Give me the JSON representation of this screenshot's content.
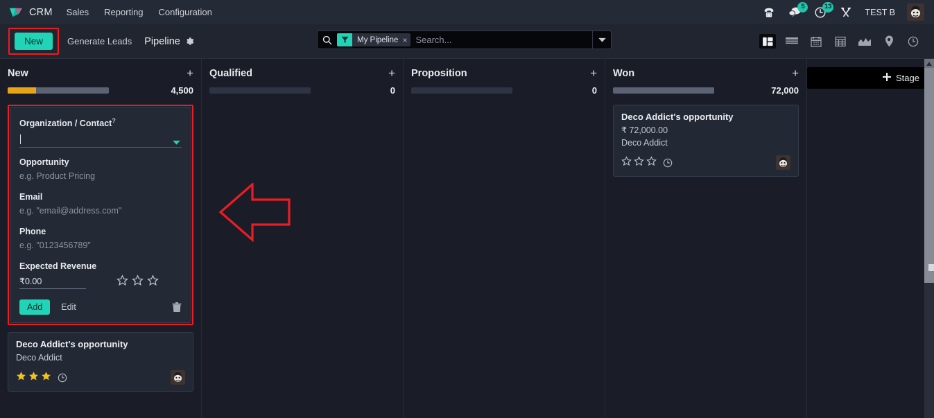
{
  "colors": {
    "accent": "#21d4b8",
    "highlight": "#ec1c24",
    "progress_orange": "#e8a317",
    "background": "#1a1d27",
    "navbar": "#252a37",
    "star_filled": "#f0c419"
  },
  "navbar": {
    "brand": "CRM",
    "logo_icon": "odoo-diamond-logo-icon",
    "menu": [
      {
        "label": "Sales",
        "name": "menu-sales"
      },
      {
        "label": "Reporting",
        "name": "menu-reporting"
      },
      {
        "label": "Configuration",
        "name": "menu-configuration"
      }
    ],
    "right": {
      "phone_icon": "phone-icon",
      "messages_icon": "chat-bubble-icon",
      "messages_count": "5",
      "activities_icon": "clock-icon",
      "activities_count": "13",
      "tools_icon": "wrench-screwdriver-icon",
      "user_name": "TEST B",
      "avatar_icon": "user-avatar"
    }
  },
  "control_panel": {
    "new_label": "New",
    "generate_leads_label": "Generate Leads",
    "view_title": "Pipeline",
    "gear_icon": "gear-icon",
    "search": {
      "search_icon": "search-icon",
      "facet_icon": "filter-funnel-icon",
      "facet_label": "My Pipeline",
      "facet_remove": "×",
      "placeholder": "Search...",
      "value": "",
      "dropdown_icon": "chevron-down-icon"
    },
    "views": [
      {
        "name": "view-kanban",
        "icon": "kanban-icon",
        "active": true
      },
      {
        "name": "view-list",
        "icon": "list-icon",
        "active": false
      },
      {
        "name": "view-calendar",
        "icon": "calendar-icon",
        "active": false
      },
      {
        "name": "view-pivot",
        "icon": "pivot-table-icon",
        "active": false
      },
      {
        "name": "view-graph",
        "icon": "area-chart-icon",
        "active": false
      },
      {
        "name": "view-map",
        "icon": "map-pin-icon",
        "active": false
      },
      {
        "name": "view-activity",
        "icon": "clock-icon",
        "active": false
      }
    ]
  },
  "kanban": {
    "add_stage_label": "Stage",
    "add_stage_icon": "plus-icon",
    "columns": [
      {
        "title": "New",
        "count": "4,500",
        "add_icon": "plus-icon",
        "progress": [
          {
            "color": "#e8a317",
            "pct": 28
          },
          {
            "color": "#5b6274",
            "pct": 72
          }
        ],
        "quick_create": {
          "fields": {
            "org_label": "Organization / Contact",
            "org_help": "?",
            "org_value": "",
            "opportunity_label": "Opportunity",
            "opportunity_placeholder": "e.g. Product Pricing",
            "email_label": "Email",
            "email_placeholder": "e.g. \"email@address.com\"",
            "phone_label": "Phone",
            "phone_placeholder": "e.g. \"0123456789\"",
            "revenue_label": "Expected Revenue",
            "revenue_value": "₹0.00",
            "priority_stars": 0
          },
          "add_label": "Add",
          "edit_label": "Edit",
          "delete_icon": "trash-icon"
        },
        "cards": [
          {
            "title": "Deco Addict's opportunity",
            "revenue": "",
            "partner": "Deco Addict",
            "stars_filled": 3,
            "clock_icon": "clock-icon",
            "avatar_icon": "user-avatar"
          }
        ]
      },
      {
        "title": "Qualified",
        "count": "0",
        "add_icon": "plus-icon",
        "progress": [
          {
            "color": "#2e3443",
            "pct": 100
          }
        ],
        "cards": []
      },
      {
        "title": "Proposition",
        "count": "0",
        "add_icon": "plus-icon",
        "progress": [
          {
            "color": "#2e3443",
            "pct": 100
          }
        ],
        "cards": []
      },
      {
        "title": "Won",
        "count": "72,000",
        "add_icon": "plus-icon",
        "progress": [
          {
            "color": "#5b6274",
            "pct": 100
          }
        ],
        "cards": [
          {
            "title": "Deco Addict's opportunity",
            "revenue": "₹ 72,000.00",
            "partner": "Deco Addict",
            "stars_filled": 0,
            "clock_icon": "clock-icon",
            "avatar_icon": "user-avatar"
          }
        ]
      }
    ]
  },
  "annotation": {
    "arrow_icon": "left-arrow-annotation",
    "arrow_color": "#ec1c24"
  }
}
